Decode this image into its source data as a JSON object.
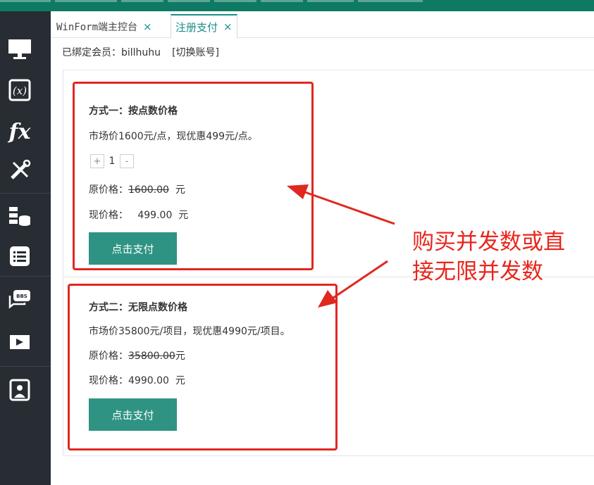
{
  "tabs": [
    {
      "label": "WinForm端主控台",
      "close": "×"
    },
    {
      "label": "注册支付",
      "close": "×"
    }
  ],
  "account": {
    "bound_label": "已绑定会员：billhuhu",
    "switch_label": "[切换账号]"
  },
  "plan1": {
    "title": "方式一：按点数价格",
    "market_price": "市场价1600元/点，现优惠499元/点。",
    "stepper": {
      "plus": "+",
      "quantity": "1",
      "minus": "-"
    },
    "original_label": "原价格：",
    "original_value": "1600.00",
    "original_unit": "元",
    "current_label": "现价格：",
    "current_value": "499.00",
    "current_unit": "元",
    "pay_label": "点击支付"
  },
  "plan2": {
    "title": "方式二：无限点数价格",
    "market_price": "市场价35800元/项目，现优惠4990元/项目。",
    "original_label": "原价格：",
    "original_value": "35800.00",
    "original_unit": "元",
    "current_label": "现价格：",
    "current_value": "4990.00",
    "current_unit": "元",
    "pay_label": "点击支付"
  },
  "annotation": {
    "line1": "购买并发数或直",
    "line2": "接无限并发数"
  },
  "colors": {
    "accent": "#2f9383",
    "highlight_red": "#e0281f",
    "sidebar": "#272d33",
    "topbar": "#0e7a63"
  },
  "sidebar_icons": [
    "monitor-icon",
    "variable-icon",
    "function-icon",
    "tools-icon",
    "database-icon",
    "list-icon",
    "bbs-icon",
    "video-icon",
    "document-icon"
  ]
}
